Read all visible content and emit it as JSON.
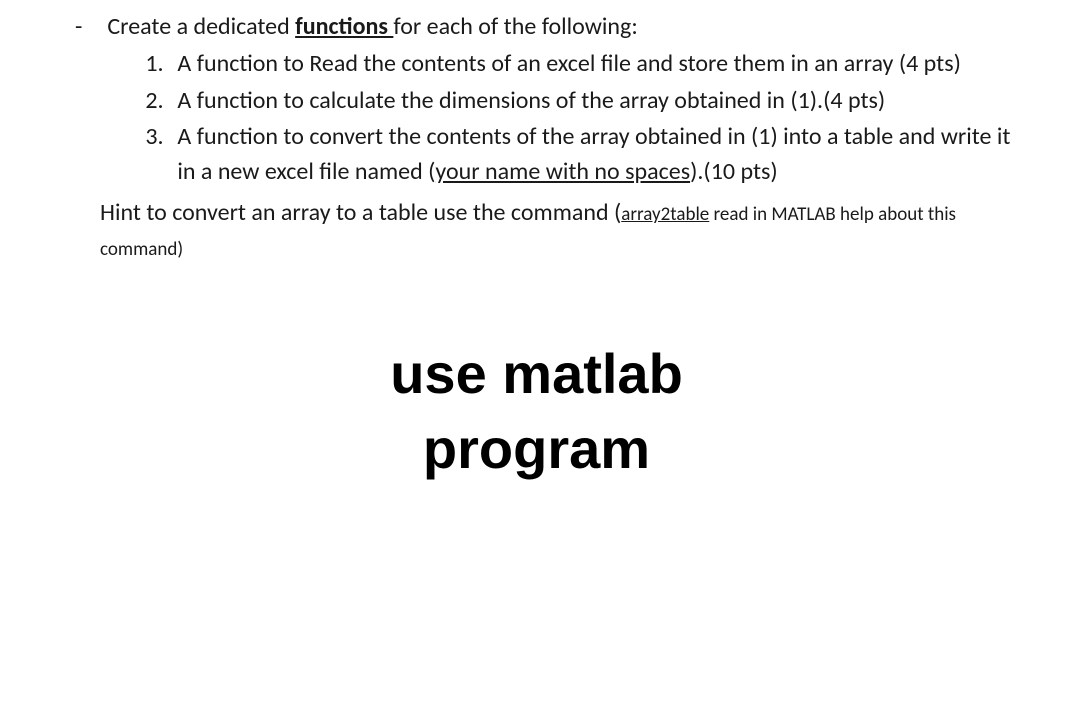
{
  "bullet": {
    "marker": "-",
    "lead_text_before": "Create a dedicated ",
    "lead_text_underlined": "functions ",
    "lead_text_after": "for each of the following:"
  },
  "items": [
    {
      "num": "1.",
      "text": "A function to Read the contents of an excel file and store them in an array (4 pts)"
    },
    {
      "num": "2.",
      "text": "A function to calculate the dimensions of the array obtained in (1).(4 pts)"
    },
    {
      "num": "3.",
      "text_before": "A function to convert the contents of the array obtained in (1) into a table and write it in a new excel file named (",
      "text_underlined": "your name with no spaces",
      "text_after": ").(10 pts)"
    }
  ],
  "hint": {
    "prefix": "Hint to convert an array to a table use the command (",
    "command": "array2table",
    "suffix_small": " read in MATLAB help about this command)"
  },
  "overlay": {
    "line1": "use matlab",
    "line2": "program"
  }
}
